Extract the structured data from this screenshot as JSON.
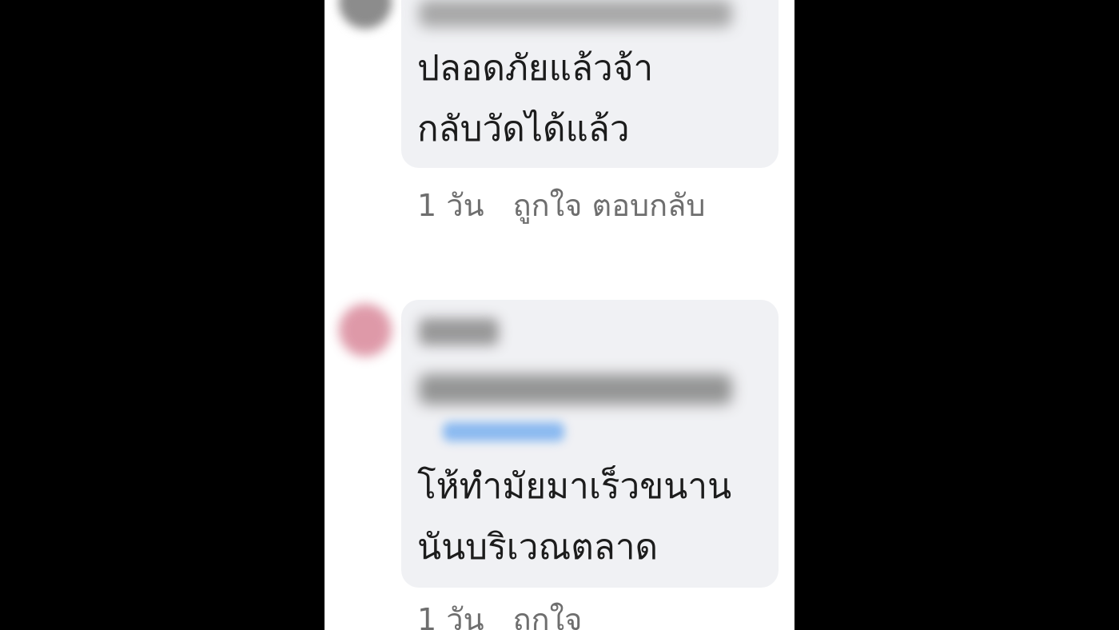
{
  "comments": [
    {
      "text_lines": [
        "ปลอดภัยแล้วจ้า",
        "กลับวัดได้แล้ว"
      ],
      "time": "1 วัน",
      "like_label": "ถูกใจ",
      "reply_label": "ตอบกลับ"
    },
    {
      "text_lines": [
        "โห้ทำมัยมาเร็วขนาน",
        "นันบริเวณตลาด"
      ],
      "time": "1 วัน",
      "like_label": "ถูกใจ"
    }
  ]
}
